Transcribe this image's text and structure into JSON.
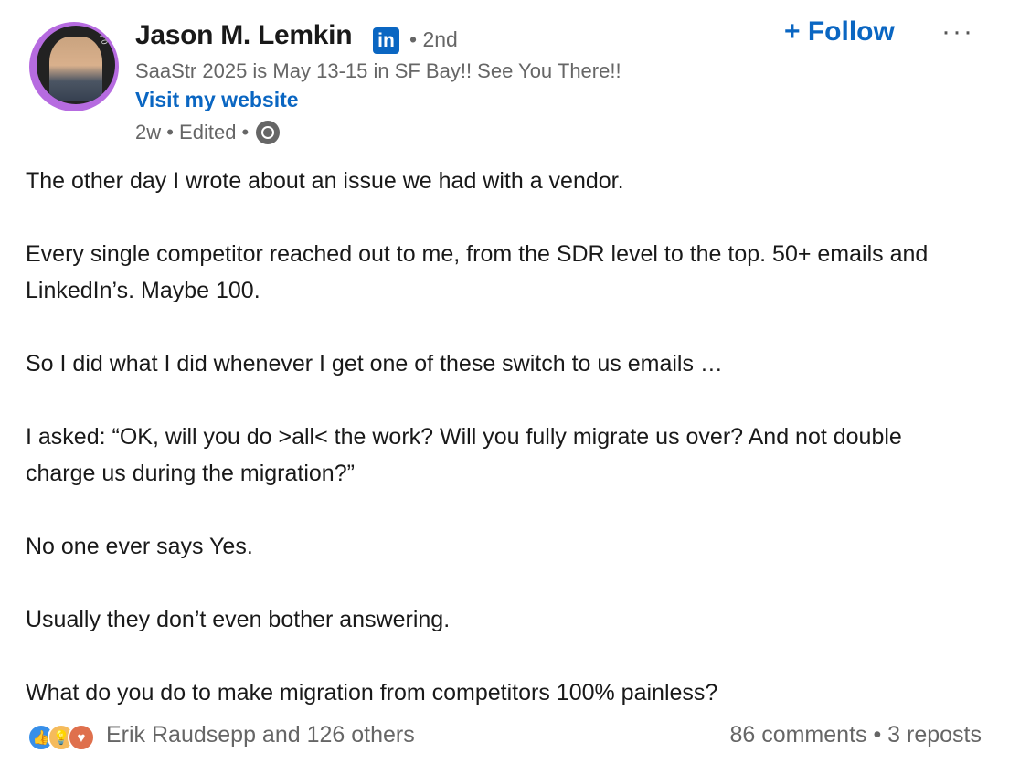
{
  "author": {
    "name": "Jason M. Lemkin",
    "badge": "in",
    "degree": "• 2nd",
    "headline": "SaaStr 2025 is May 13-15 in SF Bay!! See You There!!",
    "website_label": "Visit my website",
    "meta": "2w • Edited •",
    "avatar_ring_text": "#SAASTR20"
  },
  "actions": {
    "follow_label": "+ Follow",
    "more_label": "···"
  },
  "post": {
    "paragraphs": [
      "The other day I wrote about an issue we had with a vendor.",
      "Every single competitor reached out to me, from the SDR level to the top. 50+ emails and LinkedIn’s. Maybe 100.",
      "So I did what I did whenever I get one of these switch to us emails …",
      "I asked: “OK, will you do >all< the work? Will you fully migrate us over? And not double charge us during the migration?”",
      "No one ever says Yes.",
      "Usually they don’t even bother answering.",
      "What do you do to make migration from competitors 100% painless?"
    ]
  },
  "footer": {
    "reactions": [
      "like-icon",
      "insightful-icon",
      "love-icon"
    ],
    "reactors": "Erik Raudsepp and 126 others",
    "counts": "86 comments • 3 reposts"
  },
  "colors": {
    "link": "#0a66c2",
    "muted": "#666666",
    "text": "#191919"
  }
}
